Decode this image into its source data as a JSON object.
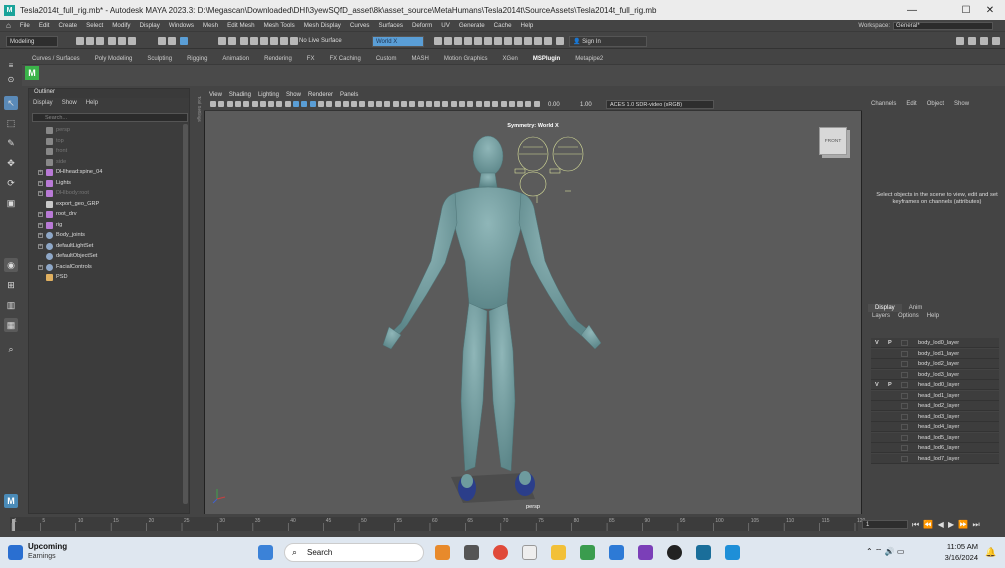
{
  "window": {
    "title": "Tesla2014t_full_rig.mb* - Autodesk MAYA 2023.3: D:\\Megascan\\Downloaded\\DHI\\3yewSQfD_asset\\8k\\asset_source\\MetaHumans\\Tesla2014t\\SourceAssets\\Tesla2014t_full_rig.mb",
    "minimize": "—",
    "maximize": "☐",
    "close": "✕"
  },
  "menubar": {
    "items": [
      "File",
      "Edit",
      "Create",
      "Select",
      "Modify",
      "Display",
      "Windows",
      "Mesh",
      "Edit Mesh",
      "Mesh Tools",
      "Mesh Display",
      "Curves",
      "Surfaces",
      "Deform",
      "UV",
      "Generate",
      "Cache",
      "Help"
    ],
    "workspace_label": "Workspace:",
    "workspace_value": "General*"
  },
  "statusline": {
    "mode": "Modeling",
    "live_surface": "No Live Surface",
    "world_field": "World X",
    "sign_in": "Sign In"
  },
  "shelf": {
    "tabs": [
      "Curves / Surfaces",
      "Poly Modeling",
      "Sculpting",
      "Rigging",
      "Animation",
      "Rendering",
      "FX",
      "FX Caching",
      "Custom",
      "MASH",
      "Motion Graphics",
      "XGen",
      "MSPlugin",
      "Metapipe2"
    ],
    "active_tab": "MSPlugin",
    "plugin_letter": "M"
  },
  "outliner": {
    "title": "Outliner",
    "menu": [
      "Display",
      "Show",
      "Help"
    ],
    "search_placeholder": "Search...",
    "items": [
      {
        "label": "persp",
        "dim": true,
        "expand": false,
        "icon": "camera-icon"
      },
      {
        "label": "top",
        "dim": true,
        "expand": false,
        "icon": "camera-icon"
      },
      {
        "label": "front",
        "dim": true,
        "expand": false,
        "icon": "camera-icon"
      },
      {
        "label": "side",
        "dim": true,
        "expand": false,
        "icon": "camera-icon"
      },
      {
        "label": "DHIhead:spine_04",
        "dim": false,
        "expand": true,
        "icon": "joint-icon"
      },
      {
        "label": "Lights",
        "dim": false,
        "expand": true,
        "icon": "joint-icon"
      },
      {
        "label": "DHIbody:root",
        "dim": true,
        "expand": true,
        "icon": "joint-icon"
      },
      {
        "label": "export_geo_GRP",
        "dim": false,
        "expand": false,
        "icon": "group-icon"
      },
      {
        "label": "root_drv",
        "dim": false,
        "expand": true,
        "icon": "joint-icon"
      },
      {
        "label": "rig",
        "dim": false,
        "expand": true,
        "icon": "joint-icon"
      },
      {
        "label": "Body_joints",
        "dim": false,
        "expand": true,
        "icon": "set-icon"
      },
      {
        "label": "defaultLightSet",
        "dim": false,
        "expand": true,
        "icon": "set-icon"
      },
      {
        "label": "defaultObjectSet",
        "dim": false,
        "expand": false,
        "icon": "set-icon"
      },
      {
        "label": "FacialControls",
        "dim": false,
        "expand": true,
        "icon": "set-icon"
      },
      {
        "label": "PSD",
        "dim": false,
        "expand": false,
        "icon": "psd-icon"
      }
    ]
  },
  "viewport": {
    "menu": [
      "View",
      "Shading",
      "Lighting",
      "Show",
      "Renderer",
      "Panels"
    ],
    "symmetry_label": "Symmetry: World X",
    "camera_label": "persp",
    "viewcube_label": "FRONT",
    "exposure": "0.00",
    "gamma": "1.00",
    "color_space": "ACES 1.0 SDR-video (sRGB)",
    "side_label": "Tool Settings"
  },
  "channelbox": {
    "menu": [
      "Channels",
      "Edit",
      "Object",
      "Show"
    ],
    "message": "Select objects in the scene to view, edit and set keyframes on channels (attributes)"
  },
  "layers": {
    "tabs": [
      "Display",
      "Anim"
    ],
    "menu": [
      "Layers",
      "Options",
      "Help"
    ],
    "rows": [
      {
        "v": "V",
        "p": "P",
        "name": "body_lod0_layer"
      },
      {
        "v": "",
        "p": "",
        "name": "body_lod1_layer"
      },
      {
        "v": "",
        "p": "",
        "name": "body_lod2_layer"
      },
      {
        "v": "",
        "p": "",
        "name": "body_lod3_layer"
      },
      {
        "v": "V",
        "p": "P",
        "name": "head_lod0_layer"
      },
      {
        "v": "",
        "p": "",
        "name": "head_lod1_layer"
      },
      {
        "v": "",
        "p": "",
        "name": "head_lod2_layer"
      },
      {
        "v": "",
        "p": "",
        "name": "head_lod3_layer"
      },
      {
        "v": "",
        "p": "",
        "name": "head_lod4_layer"
      },
      {
        "v": "",
        "p": "",
        "name": "head_lod5_layer"
      },
      {
        "v": "",
        "p": "",
        "name": "head_lod6_layer"
      },
      {
        "v": "",
        "p": "",
        "name": "head_lod7_layer"
      }
    ]
  },
  "timeline": {
    "ticks": [
      "1",
      "5",
      "10",
      "15",
      "20",
      "25",
      "30",
      "35",
      "40",
      "45",
      "50",
      "55",
      "60",
      "65",
      "70",
      "75",
      "80",
      "85",
      "90",
      "95",
      "100",
      "105",
      "110",
      "115",
      "120"
    ],
    "current_frame": "1"
  },
  "taskbar": {
    "weather_title": "Upcoming",
    "weather_sub": "Earnings",
    "search": "Search",
    "time": "11:05 AM",
    "date": "3/16/2024"
  },
  "colors": {
    "skin": "#6e9b9e",
    "accent": "#5a9ed6",
    "plugin_green": "#3bb34a"
  }
}
